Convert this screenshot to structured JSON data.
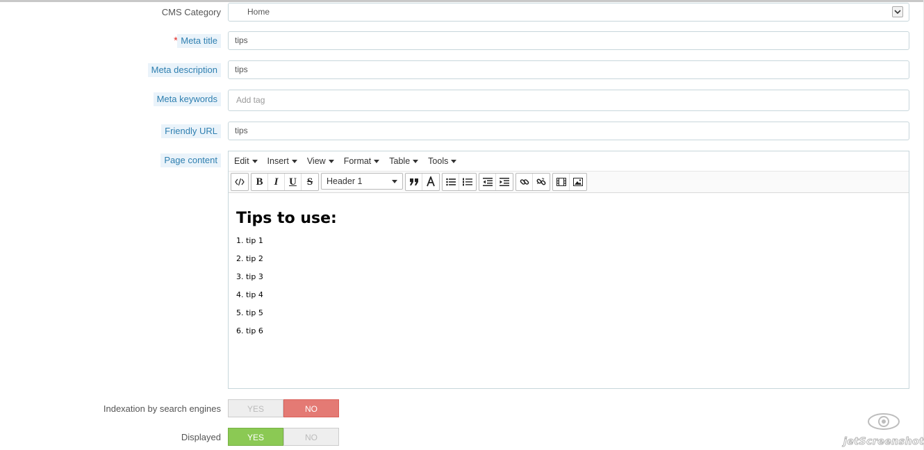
{
  "form": {
    "category": {
      "label": "CMS Category",
      "value": "Home"
    },
    "meta_title": {
      "label": "Meta title",
      "value": "tips",
      "required": true
    },
    "meta_description": {
      "label": "Meta description",
      "value": "tips"
    },
    "meta_keywords": {
      "label": "Meta keywords",
      "placeholder": "Add tag"
    },
    "friendly_url": {
      "label": "Friendly URL",
      "value": "tips",
      "required": true
    },
    "page_content": {
      "label": "Page content"
    },
    "indexation": {
      "label": "Indexation by search engines",
      "yes": "YES",
      "no": "NO",
      "selected": "NO"
    },
    "displayed": {
      "label": "Displayed",
      "yes": "YES",
      "no": "NO",
      "selected": "YES"
    }
  },
  "editor": {
    "menus": [
      "Edit",
      "Insert",
      "View",
      "Format",
      "Table",
      "Tools"
    ],
    "format_select": "Header 1",
    "toolbar_icons": [
      "code-icon",
      "bold-icon",
      "italic-icon",
      "underline-icon",
      "strikethrough-icon",
      "blockquote-icon",
      "text-color-icon",
      "bullet-list-icon",
      "numbered-list-icon",
      "outdent-icon",
      "indent-icon",
      "link-icon",
      "unlink-icon",
      "media-icon",
      "image-icon"
    ],
    "heading": "Tips to use:",
    "list": [
      "1. tip 1",
      "2. tip 2",
      "3. tip 3",
      "4. tip 4",
      "5. tip 5",
      "6. tip 6"
    ]
  },
  "colors": {
    "accent_label": "#2e7fb0",
    "toggle_no": "#e47a74",
    "toggle_yes": "#8bc954",
    "required": "#e0322e"
  },
  "watermark": "jetScreenshot"
}
